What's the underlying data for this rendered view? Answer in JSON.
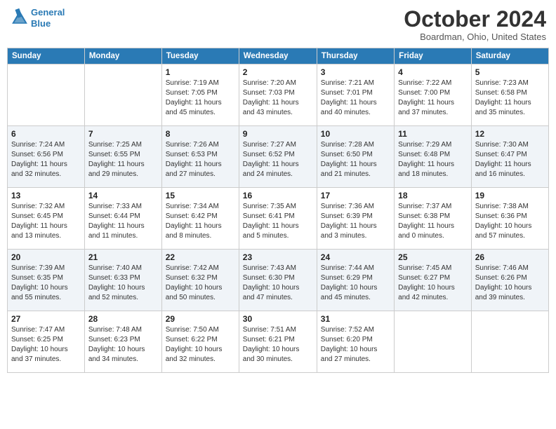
{
  "header": {
    "logo_line1": "General",
    "logo_line2": "Blue",
    "month_title": "October 2024",
    "location": "Boardman, Ohio, United States"
  },
  "days_of_week": [
    "Sunday",
    "Monday",
    "Tuesday",
    "Wednesday",
    "Thursday",
    "Friday",
    "Saturday"
  ],
  "weeks": [
    [
      {
        "day": "",
        "info": ""
      },
      {
        "day": "",
        "info": ""
      },
      {
        "day": "1",
        "info": "Sunrise: 7:19 AM\nSunset: 7:05 PM\nDaylight: 11 hours\nand 45 minutes."
      },
      {
        "day": "2",
        "info": "Sunrise: 7:20 AM\nSunset: 7:03 PM\nDaylight: 11 hours\nand 43 minutes."
      },
      {
        "day": "3",
        "info": "Sunrise: 7:21 AM\nSunset: 7:01 PM\nDaylight: 11 hours\nand 40 minutes."
      },
      {
        "day": "4",
        "info": "Sunrise: 7:22 AM\nSunset: 7:00 PM\nDaylight: 11 hours\nand 37 minutes."
      },
      {
        "day": "5",
        "info": "Sunrise: 7:23 AM\nSunset: 6:58 PM\nDaylight: 11 hours\nand 35 minutes."
      }
    ],
    [
      {
        "day": "6",
        "info": "Sunrise: 7:24 AM\nSunset: 6:56 PM\nDaylight: 11 hours\nand 32 minutes."
      },
      {
        "day": "7",
        "info": "Sunrise: 7:25 AM\nSunset: 6:55 PM\nDaylight: 11 hours\nand 29 minutes."
      },
      {
        "day": "8",
        "info": "Sunrise: 7:26 AM\nSunset: 6:53 PM\nDaylight: 11 hours\nand 27 minutes."
      },
      {
        "day": "9",
        "info": "Sunrise: 7:27 AM\nSunset: 6:52 PM\nDaylight: 11 hours\nand 24 minutes."
      },
      {
        "day": "10",
        "info": "Sunrise: 7:28 AM\nSunset: 6:50 PM\nDaylight: 11 hours\nand 21 minutes."
      },
      {
        "day": "11",
        "info": "Sunrise: 7:29 AM\nSunset: 6:48 PM\nDaylight: 11 hours\nand 18 minutes."
      },
      {
        "day": "12",
        "info": "Sunrise: 7:30 AM\nSunset: 6:47 PM\nDaylight: 11 hours\nand 16 minutes."
      }
    ],
    [
      {
        "day": "13",
        "info": "Sunrise: 7:32 AM\nSunset: 6:45 PM\nDaylight: 11 hours\nand 13 minutes."
      },
      {
        "day": "14",
        "info": "Sunrise: 7:33 AM\nSunset: 6:44 PM\nDaylight: 11 hours\nand 11 minutes."
      },
      {
        "day": "15",
        "info": "Sunrise: 7:34 AM\nSunset: 6:42 PM\nDaylight: 11 hours\nand 8 minutes."
      },
      {
        "day": "16",
        "info": "Sunrise: 7:35 AM\nSunset: 6:41 PM\nDaylight: 11 hours\nand 5 minutes."
      },
      {
        "day": "17",
        "info": "Sunrise: 7:36 AM\nSunset: 6:39 PM\nDaylight: 11 hours\nand 3 minutes."
      },
      {
        "day": "18",
        "info": "Sunrise: 7:37 AM\nSunset: 6:38 PM\nDaylight: 11 hours\nand 0 minutes."
      },
      {
        "day": "19",
        "info": "Sunrise: 7:38 AM\nSunset: 6:36 PM\nDaylight: 10 hours\nand 57 minutes."
      }
    ],
    [
      {
        "day": "20",
        "info": "Sunrise: 7:39 AM\nSunset: 6:35 PM\nDaylight: 10 hours\nand 55 minutes."
      },
      {
        "day": "21",
        "info": "Sunrise: 7:40 AM\nSunset: 6:33 PM\nDaylight: 10 hours\nand 52 minutes."
      },
      {
        "day": "22",
        "info": "Sunrise: 7:42 AM\nSunset: 6:32 PM\nDaylight: 10 hours\nand 50 minutes."
      },
      {
        "day": "23",
        "info": "Sunrise: 7:43 AM\nSunset: 6:30 PM\nDaylight: 10 hours\nand 47 minutes."
      },
      {
        "day": "24",
        "info": "Sunrise: 7:44 AM\nSunset: 6:29 PM\nDaylight: 10 hours\nand 45 minutes."
      },
      {
        "day": "25",
        "info": "Sunrise: 7:45 AM\nSunset: 6:27 PM\nDaylight: 10 hours\nand 42 minutes."
      },
      {
        "day": "26",
        "info": "Sunrise: 7:46 AM\nSunset: 6:26 PM\nDaylight: 10 hours\nand 39 minutes."
      }
    ],
    [
      {
        "day": "27",
        "info": "Sunrise: 7:47 AM\nSunset: 6:25 PM\nDaylight: 10 hours\nand 37 minutes."
      },
      {
        "day": "28",
        "info": "Sunrise: 7:48 AM\nSunset: 6:23 PM\nDaylight: 10 hours\nand 34 minutes."
      },
      {
        "day": "29",
        "info": "Sunrise: 7:50 AM\nSunset: 6:22 PM\nDaylight: 10 hours\nand 32 minutes."
      },
      {
        "day": "30",
        "info": "Sunrise: 7:51 AM\nSunset: 6:21 PM\nDaylight: 10 hours\nand 30 minutes."
      },
      {
        "day": "31",
        "info": "Sunrise: 7:52 AM\nSunset: 6:20 PM\nDaylight: 10 hours\nand 27 minutes."
      },
      {
        "day": "",
        "info": ""
      },
      {
        "day": "",
        "info": ""
      }
    ]
  ]
}
